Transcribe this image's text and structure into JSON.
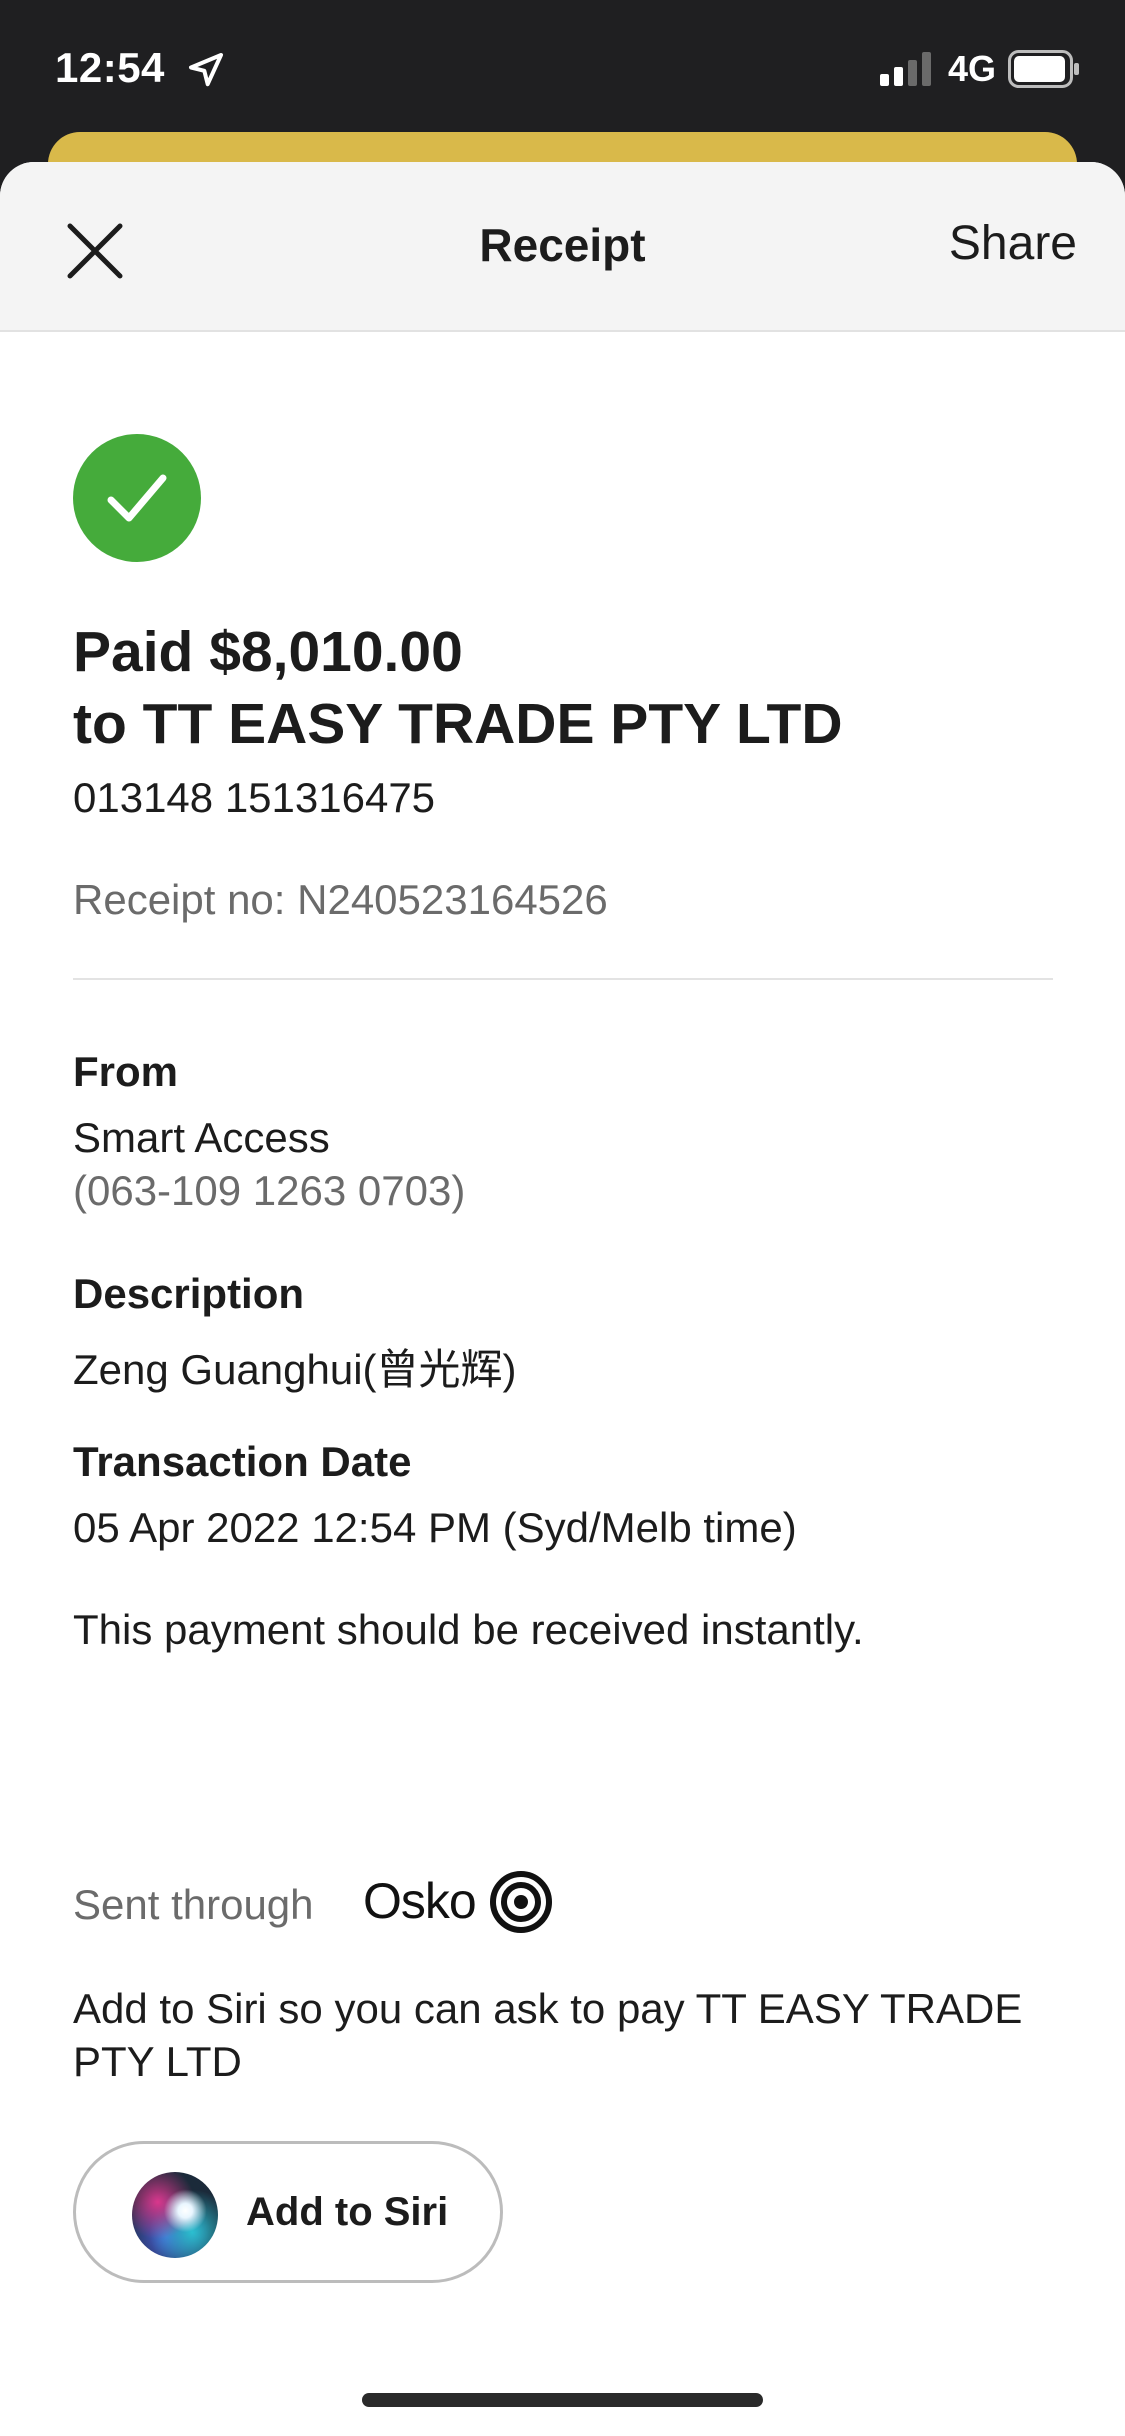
{
  "status_bar": {
    "time": "12:54",
    "network": "4G",
    "icons": [
      "location-arrow-icon",
      "signal-icon",
      "battery-icon"
    ]
  },
  "header": {
    "title": "Receipt",
    "share_label": "Share",
    "close_icon": "close-icon"
  },
  "receipt": {
    "status_icon": "check-icon",
    "status_color": "#45ab3b",
    "paid_line": "Paid $8,010.00",
    "to_line": "to TT EASY TRADE PTY LTD",
    "payee_account": "013148 151316475",
    "receipt_no": "Receipt no: N240523164526"
  },
  "details": {
    "from_label": "From",
    "from_account_name": "Smart Access",
    "from_account_number": "(063-109 1263 0703)",
    "description_label": "Description",
    "description_value": "Zeng Guanghui(曾光辉)",
    "date_label": "Transaction Date",
    "date_value": "05 Apr 2022 12:54 PM (Syd/Melb time)",
    "instant_note": "This payment should be received instantly.",
    "sent_through_label": "Sent through",
    "network_brand": "Osko"
  },
  "siri": {
    "prompt": "Add to Siri so you can ask to pay TT EASY TRADE PTY LTD",
    "button_label": "Add to Siri",
    "icon": "siri-icon"
  },
  "colors": {
    "accent_yellow": "#d9b94a",
    "success_green": "#45ab3b",
    "muted_text": "#6b6b6b"
  }
}
